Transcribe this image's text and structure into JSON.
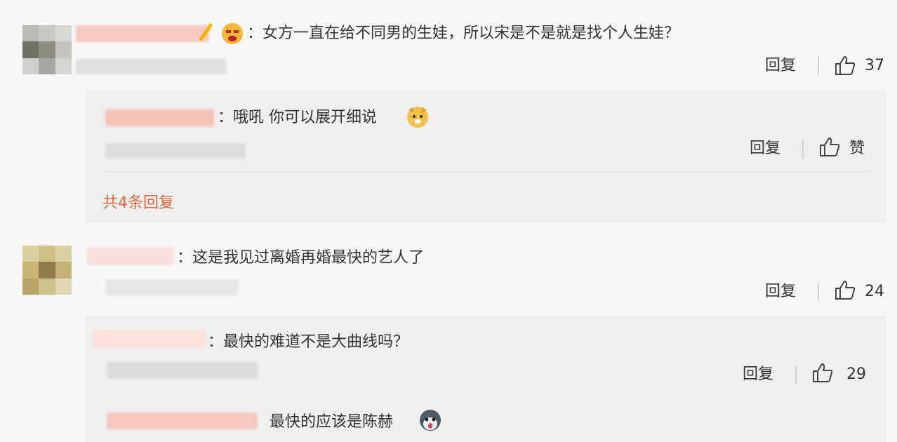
{
  "comments": [
    {
      "text": "：女方一直在给不同男的生娃，所以宋是不是就是找个人生娃？",
      "reply_label": "回复",
      "like_count": "37",
      "replies": [
        {
          "text": "：哦吼 你可以展开细说",
          "reply_label": "回复",
          "like_label": "赞"
        }
      ],
      "more_replies": "共4条回复"
    },
    {
      "text": "：这是我见过离婚再婚最快的艺人了",
      "reply_label": "回复",
      "like_count": "24",
      "replies": [
        {
          "text": "：最快的难道不是大曲线吗？",
          "reply_label": "回复",
          "like_count": "29"
        },
        {
          "text": "最快的应该是陈赫"
        }
      ]
    }
  ],
  "icons": {
    "like": "thumb-up-icon",
    "emoji_angry": "angry-face-emoji",
    "emoji_dog": "dog-face-emoji",
    "emoji_husky": "husky-face-emoji"
  },
  "colors": {
    "accent": "#e06b3d",
    "background": "#f7f7f7",
    "reply_background": "#efefef",
    "name_blur": "#f6c2b8"
  }
}
